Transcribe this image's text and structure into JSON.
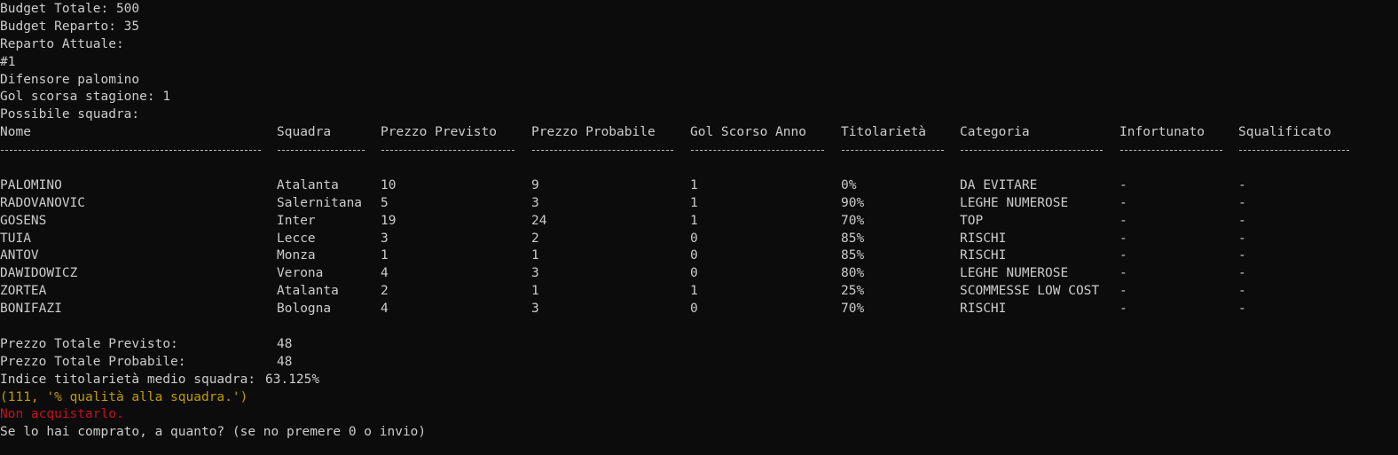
{
  "header": {
    "budget_totale": "Budget Totale: 500",
    "budget_reparto": "Budget Reparto: 35",
    "reparto_attuale": "Reparto Attuale:",
    "numero": "#1",
    "giocatore": "Difensore palomino",
    "gol_scorsa_stagione": "Gol scorsa stagione: 1",
    "possibile_squadra": "Possibile squadra:"
  },
  "table": {
    "columns": [
      "Nome",
      "Squadra",
      "Prezzo Previsto",
      "Prezzo Probabile",
      "Gol Scorso Anno",
      "Titolarietà",
      "Categoria",
      "Infortunato",
      "Squalificato"
    ],
    "rows": [
      [
        "PALOMINO",
        "Atalanta",
        "10",
        "9",
        "1",
        "0%",
        "DA EVITARE",
        "-",
        "-"
      ],
      [
        "RADOVANOVIC",
        "Salernitana",
        "5",
        "3",
        "1",
        "90%",
        "LEGHE NUMEROSE",
        "-",
        "-"
      ],
      [
        "GOSENS",
        "Inter",
        "19",
        "24",
        "1",
        "70%",
        "TOP",
        "-",
        "-"
      ],
      [
        "TUIA",
        "Lecce",
        "3",
        "2",
        "0",
        "85%",
        "RISCHI",
        "-",
        "-"
      ],
      [
        "ANTOV",
        "Monza",
        "1",
        "1",
        "0",
        "85%",
        "RISCHI",
        "-",
        "-"
      ],
      [
        "DAWIDOWICZ",
        "Verona",
        "4",
        "3",
        "0",
        "80%",
        "LEGHE NUMEROSE",
        "-",
        "-"
      ],
      [
        "ZORTEA",
        "Atalanta",
        "2",
        "1",
        "1",
        "25%",
        "SCOMMESSE LOW COST",
        "-",
        "-"
      ],
      [
        "BONIFAZI",
        "Bologna",
        "4",
        "3",
        "0",
        "70%",
        "RISCHI",
        "-",
        "-"
      ]
    ]
  },
  "summary": {
    "prezzo_totale_previsto_label": "Prezzo Totale Previsto:",
    "prezzo_totale_previsto_value": "48",
    "prezzo_totale_probabile_label": "Prezzo Totale Probabile:",
    "prezzo_totale_probabile_value": "48",
    "indice_label": "Indice titolarietà medio squadra:",
    "indice_value": "63.125%",
    "qualita": "(111, '% qualità alla squadra.')",
    "avviso": "Non acquistarlo.",
    "prompt": "Se lo hai comprato, a quanto? (se no premere 0 o invio)"
  },
  "colors": {
    "background": "#0c0c0c",
    "text": "#cccccc",
    "warning_yellow": "#c19c00",
    "alert_red": "#c50f1f"
  }
}
